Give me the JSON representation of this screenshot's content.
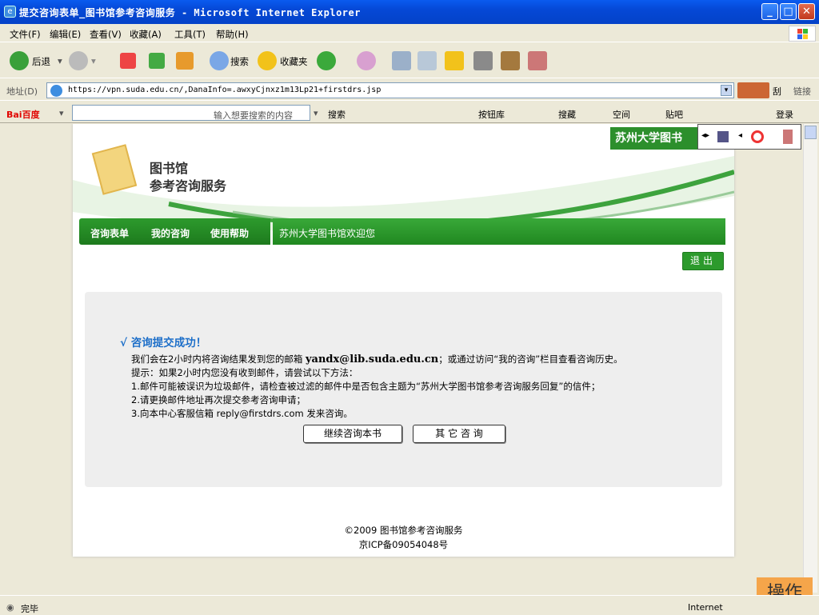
{
  "window": {
    "title": "提交咨询表单_图书馆参考咨询服务 - Microsoft Internet Explorer"
  },
  "menu": [
    "文件(F)",
    "编辑(E)",
    "查看(V)",
    "收藏(A)",
    "工具(T)",
    "帮助(H)"
  ],
  "toolbar": {
    "back": "后退",
    "search": "搜索",
    "favorites": "收藏夹"
  },
  "address": {
    "label": "地址(D)",
    "url": "https://vpn.suda.edu.cn/,DanaInfo=.awxyCjnxz1m13Lp21+firstdrs.jsp",
    "links": "链接"
  },
  "baidu": {
    "logo": "Bai百度",
    "placeholder": "输入想要搜索的内容",
    "search": "搜索",
    "buttons": "按钮库",
    "collect": "搜藏",
    "space": "空间",
    "tieba": "贴吧",
    "login": "登录"
  },
  "page": {
    "brand_top": "苏州大学图书",
    "logo_line1": "图书馆",
    "logo_line2": "参考咨询服务",
    "nav": [
      "咨询表单",
      "我的咨询",
      "使用帮助"
    ],
    "welcome": "苏州大学图书馆欢迎您",
    "logout": "退出",
    "success_title": "√ 咨询提交成功！",
    "msg1_pre": "我们会在2小时内将咨询结果发到您的邮箱",
    "msg1_email": "yandx@lib.suda.edu.cn",
    "msg1_post": "；或通过访问“我的咨询”栏目查看咨询历史。",
    "msg2": "提示：如果2小时内您没有收到邮件，请尝试以下方法：",
    "msg3": "1.邮件可能被误识为垃圾邮件，请检查被过滤的邮件中是否包含主题为“苏州大学图书馆参考咨询服务回复”的信件；",
    "msg4": "2.请更换邮件地址再次提交参考咨询申请；",
    "msg5": "3.向本中心客服信箱 reply@firstdrs.com 发来咨询。",
    "btn_continue": "继续咨询本书",
    "btn_other": "其 它 咨 询",
    "footer1": "©2009 图书馆参考咨询服务",
    "footer2": "京ICP备09054048号"
  },
  "status": {
    "text": "完毕",
    "zone": "Internet"
  },
  "overlay": "操作",
  "colors": {
    "title_blue": "#0A5BEF",
    "nav_green": "#2D9A2D",
    "success_blue": "#1D6FC9"
  }
}
